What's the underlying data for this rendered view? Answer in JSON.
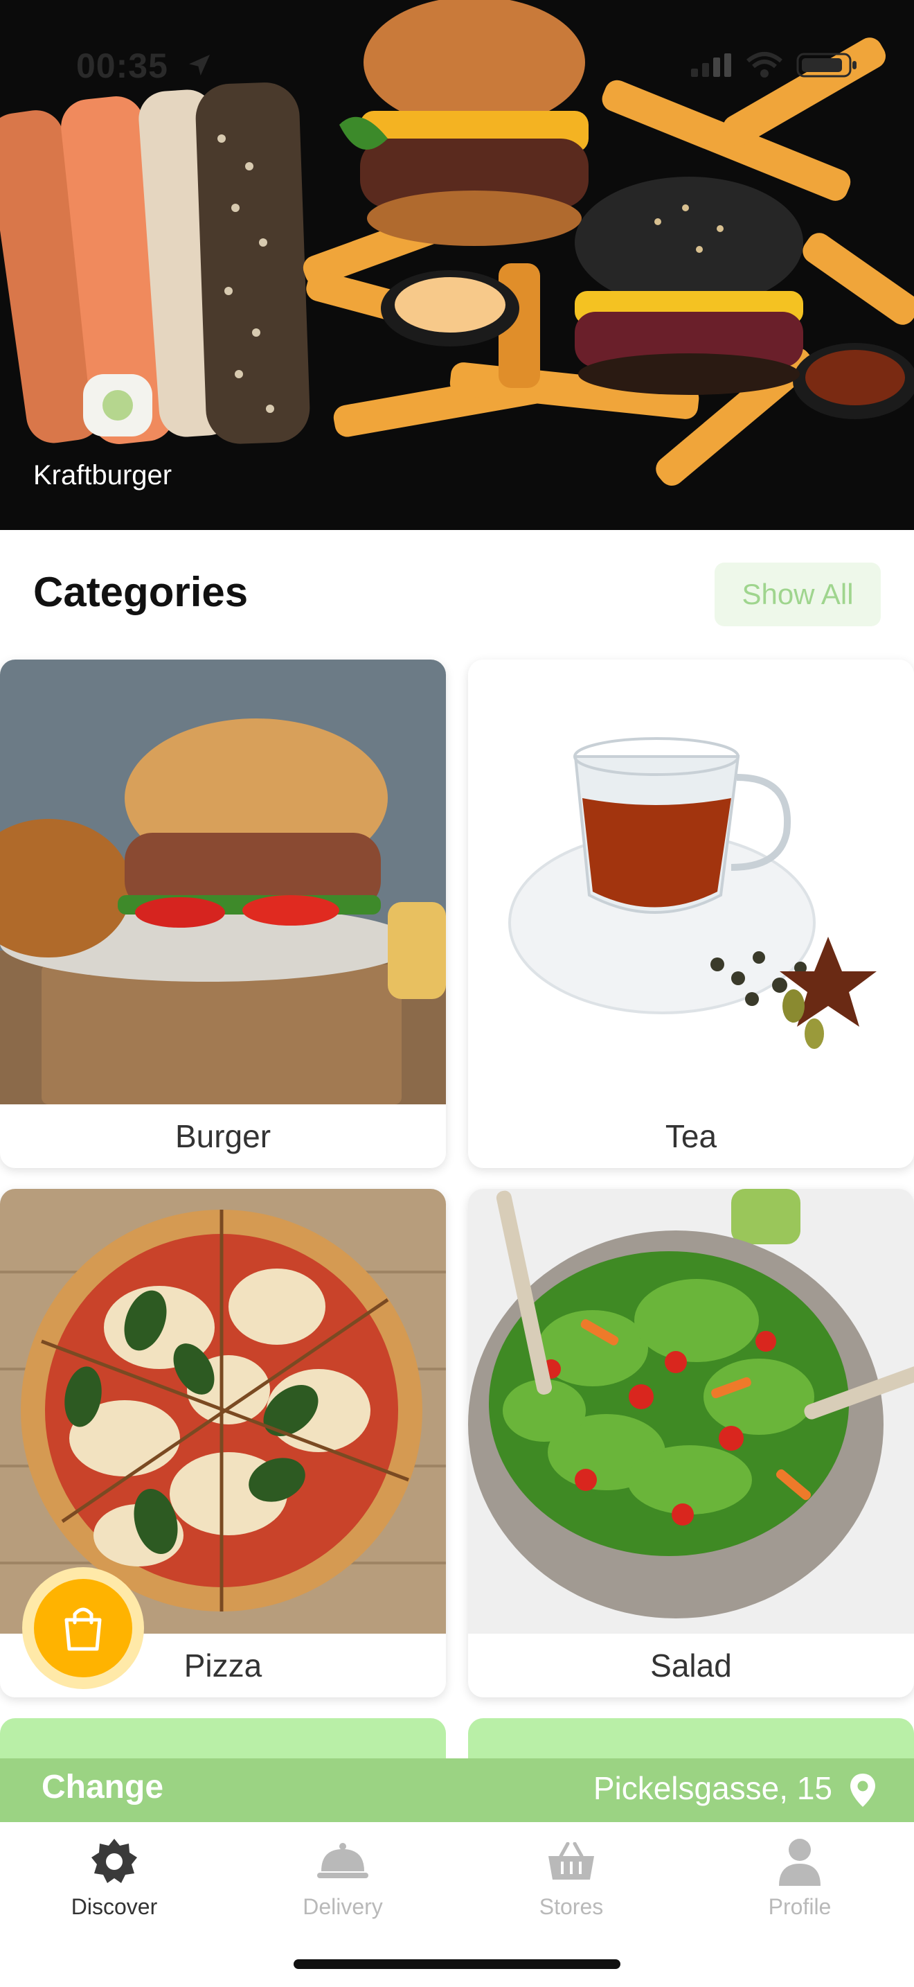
{
  "status_bar": {
    "time": "00:35"
  },
  "hero": {
    "caption": "Kraftburger"
  },
  "categories_section": {
    "title": "Categories",
    "show_all_label": "Show All"
  },
  "categories": [
    {
      "label": "Burger"
    },
    {
      "label": "Tea"
    },
    {
      "label": "Pizza"
    },
    {
      "label": "Salad"
    }
  ],
  "address_bar": {
    "change_label": "Change",
    "address": "Pickelsgasse, 15"
  },
  "tabs": [
    {
      "label": "Discover",
      "icon": "discover-icon",
      "active": true
    },
    {
      "label": "Delivery",
      "icon": "cloche-icon",
      "active": false
    },
    {
      "label": "Stores",
      "icon": "basket-icon",
      "active": false
    },
    {
      "label": "Profile",
      "icon": "person-icon",
      "active": false
    }
  ],
  "colors": {
    "accent_green": "#9bd383",
    "light_green": "#b9efa7",
    "basket_orange": "#ffb300",
    "tab_active": "#333333",
    "tab_inactive": "#b9b9b9"
  }
}
